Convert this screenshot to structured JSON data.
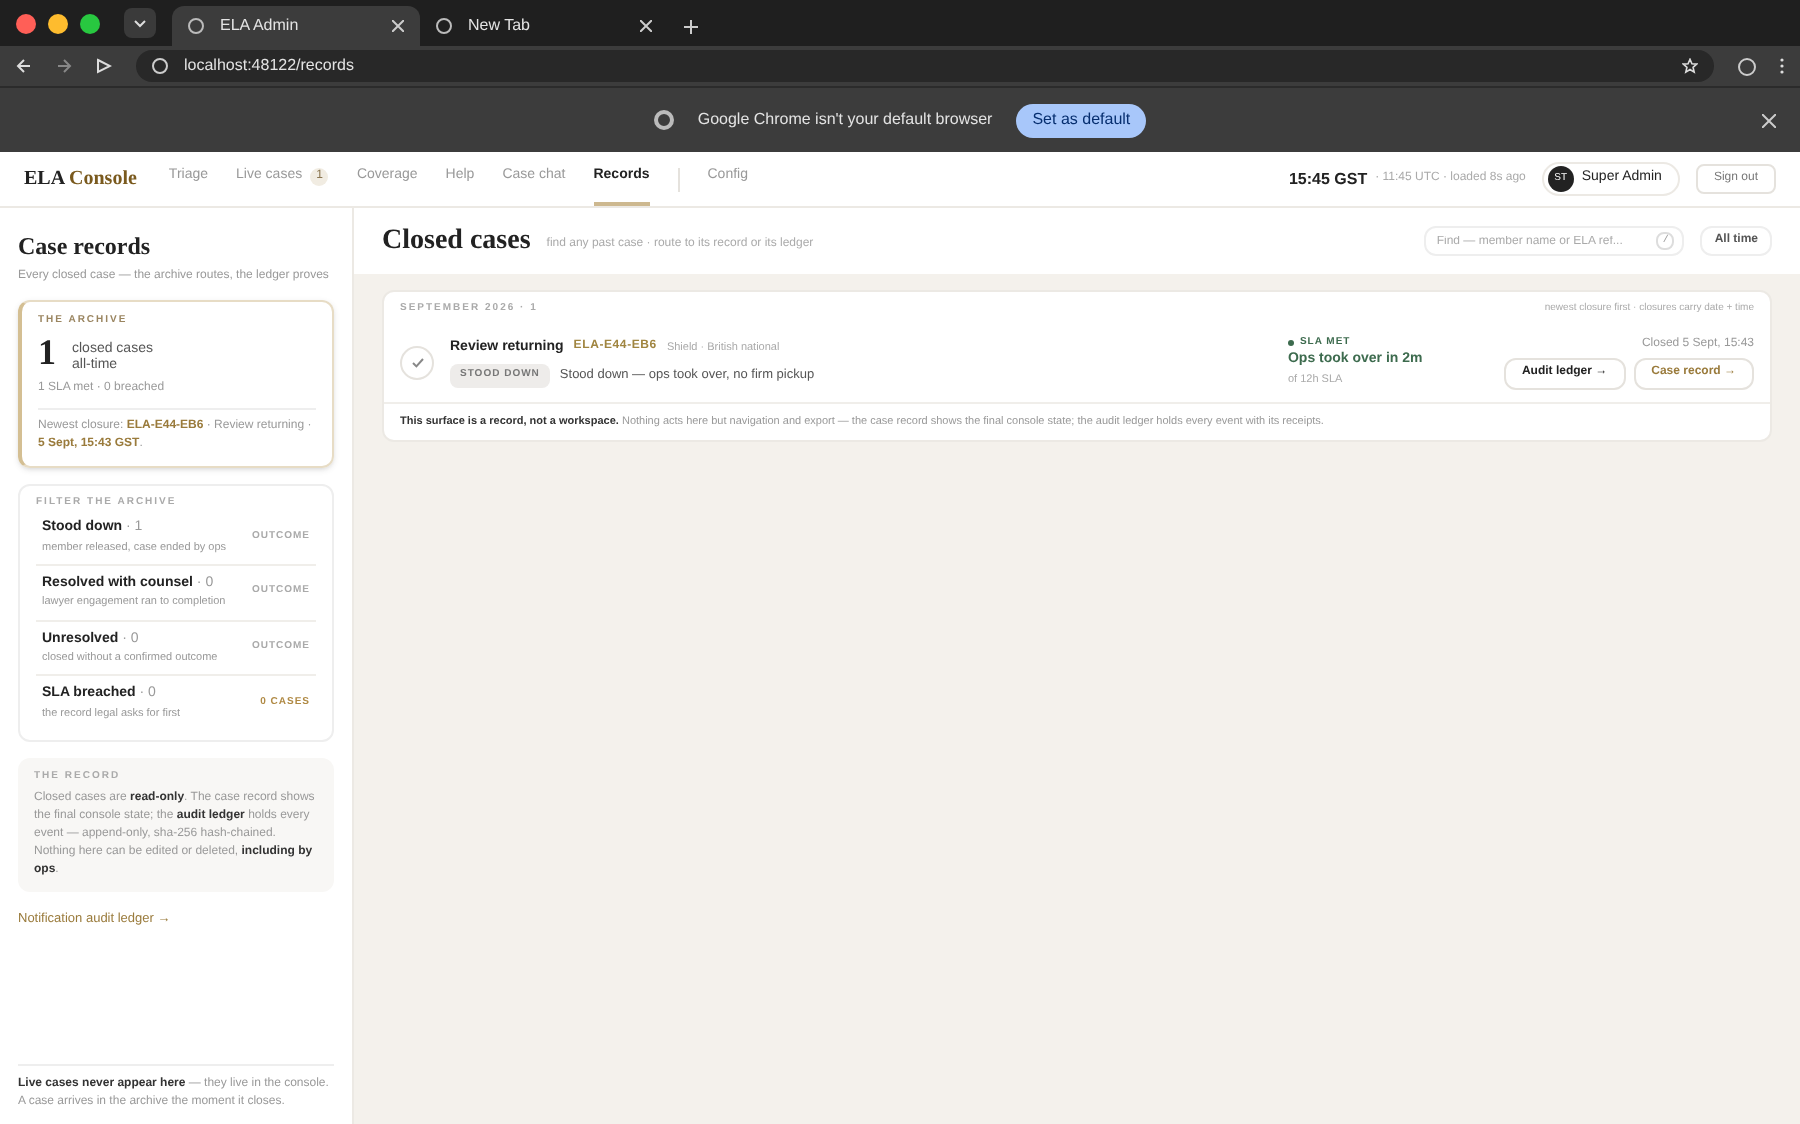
{
  "browser": {
    "tabs": [
      {
        "title": "ELA Admin",
        "selected": true
      },
      {
        "title": "New Tab",
        "selected": false
      }
    ],
    "url": "localhost:48122/records",
    "infobar": {
      "message": "Google Chrome isn't your default browser",
      "button": "Set as default"
    }
  },
  "header": {
    "brand": [
      "ELA",
      "Console"
    ],
    "nav": [
      {
        "label": "Triage",
        "selected": false
      },
      {
        "label": "Live cases",
        "badge": "1",
        "selected": false
      },
      {
        "label": "Coverage",
        "selected": false
      },
      {
        "label": "Help",
        "selected": false
      },
      {
        "label": "Case chat",
        "selected": false
      },
      {
        "label": "Records",
        "selected": true
      },
      {
        "label": "Config",
        "selected": false,
        "separated": true
      }
    ],
    "time": "15:45 GST",
    "time_detail": "· 11:45 UTC · loaded 8s ago",
    "user": {
      "initials": "ST",
      "name": "Super Admin"
    },
    "sign_out": "Sign out"
  },
  "sidebar": {
    "title": "Case records",
    "subtitle": "Every closed case — the archive routes, the ledger proves",
    "archive": {
      "heading": "THE ARCHIVE",
      "count": "1",
      "count_label": "closed cases",
      "count_period": "all-time",
      "stats": "1 SLA met · 0 breached",
      "newest": "Newest closure: **ELA-E44-EB6** · Review returning · **5 Sept, 15:43 GST**."
    },
    "filters": {
      "heading": "FILTER THE ARCHIVE",
      "items": [
        {
          "label": "Stood down",
          "count": "· 1",
          "note": "member released, case ended by ops",
          "tag": "OUTCOME",
          "kind": "outcome"
        },
        {
          "label": "Resolved with counsel",
          "count": "· 0",
          "note": "lawyer engagement ran to completion",
          "tag": "OUTCOME",
          "kind": "outcome"
        },
        {
          "label": "Unresolved",
          "count": "· 0",
          "note": "closed without a confirmed outcome",
          "tag": "OUTCOME",
          "kind": "outcome"
        },
        {
          "label": "SLA breached",
          "count": "· 0",
          "note": "the record legal asks for first",
          "tag": "0 CASES",
          "kind": "count"
        }
      ]
    },
    "record": {
      "heading": "THE RECORD",
      "text": "Closed cases are **read-only**. The case record shows the final console state; the **audit ledger** holds every event — append-only, sha-256 hash-chained. Nothing here can be edited or deleted, **including by ops**."
    },
    "link": "Notification audit ledger →",
    "footer": "**Live cases never appear here** — they live in the console. A case arrives in the archive the moment it closes."
  },
  "main": {
    "title": "Closed cases",
    "subtitle": "find any past case · route to its record or its ledger",
    "search": {
      "placeholder": "Find — member name or ELA ref...",
      "shortcut": "/"
    },
    "range": "All time",
    "group": {
      "heading": "SEPTEMBER 2026 · 1",
      "sort_note": "newest closure first · closures carry date + time",
      "cases": [
        {
          "title": "Review returning",
          "ref": "ELA-E44-EB6",
          "meta": "Shield · British national",
          "status": "STOOD DOWN",
          "summary": "Stood down — ops took over, no firm pickup",
          "sla_met": true,
          "sla_label": "SLA MET",
          "sla_value": "Ops took over in 2m",
          "sla_note": "of 12h SLA",
          "closed": "Closed 5 Sept, 15:43",
          "actions": [
            {
              "label": "Audit ledger →",
              "kind": "plain"
            },
            {
              "label": "Case record →",
              "kind": "accent"
            }
          ]
        }
      ]
    },
    "note": "**This surface is a record, not a workspace.** Nothing acts here but navigation and export — the case record shows the final console state; the audit ledger holds every event with its receipts."
  }
}
